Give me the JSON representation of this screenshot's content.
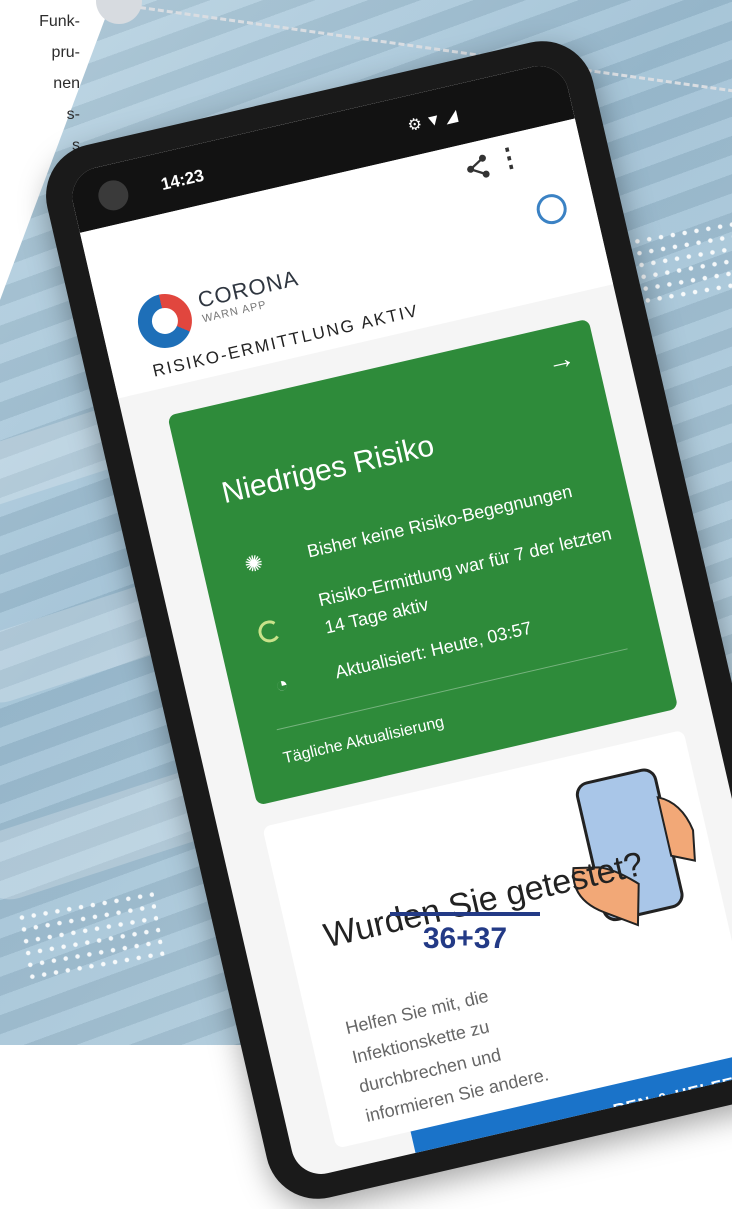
{
  "article": {
    "lines": [
      "Funk-",
      "pru-",
      "nen",
      "s-",
      "s"
    ]
  },
  "phone": {
    "status_time": "14:23",
    "app_name": "CORONA",
    "app_subtitle": "WARN APP",
    "risk_status": "RISIKO-ERMITTLUNG AKTIV",
    "risk_card": {
      "title": "Niedriges Risiko",
      "line1": "Bisher keine Risiko-Begegnungen",
      "line2": "Risiko-Ermittlung war für 7 der letzten 14 Tage aktiv",
      "line3": "Aktualisiert: Heute, 03:57",
      "footer": "Tägliche Aktualisierung",
      "color": "#2e8b3a"
    },
    "test_card": {
      "title": "Wurden Sie getestet?",
      "body": "Helfen Sie mit, die Infektionskette zu durchbrechen und informieren Sie andere.",
      "cta": "REN & HELFEN",
      "cta_color": "#1a73c9"
    }
  },
  "page_number": "36+37",
  "colors": {
    "page_number": "#233a86",
    "accent_ring": "#3b82c4"
  }
}
